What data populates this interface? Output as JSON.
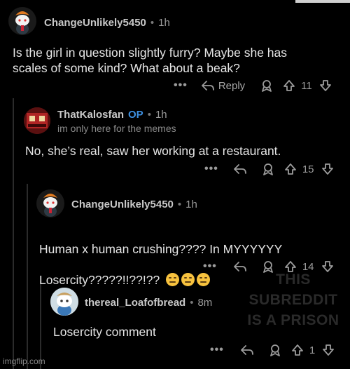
{
  "comments": [
    {
      "user": "ChangeUnlikely5450",
      "time": "1h",
      "text": "Is the girl in question slightly furry?  Maybe she has\nscales of some kind?  What about a beak?",
      "reply_label": "Reply",
      "score": "11"
    },
    {
      "user": "ThatKalosfan",
      "op_badge": "OP",
      "time": "1h",
      "flair": "im only here for the memes",
      "text": "No, she’s real, saw her working at a restaurant.",
      "score": "15"
    },
    {
      "user": "ChangeUnlikely5450",
      "time": "1h",
      "text_line1": "Human x human crushing???? In MYYYYYY",
      "text_line2": "Losercity?????!!??!??",
      "score": "14"
    },
    {
      "user": "thereal_Loafofbread",
      "time": "8m",
      "text": "Losercity comment",
      "score": "1"
    }
  ],
  "watermark": "THIS\nSUBREDDIT\nIS A PRISON",
  "imgflip": "imgflip.com",
  "colors": {
    "background": "#000000",
    "op_blue": "#3d8fe0",
    "text": "#e6e6e6",
    "muted": "#9b9b9b"
  }
}
